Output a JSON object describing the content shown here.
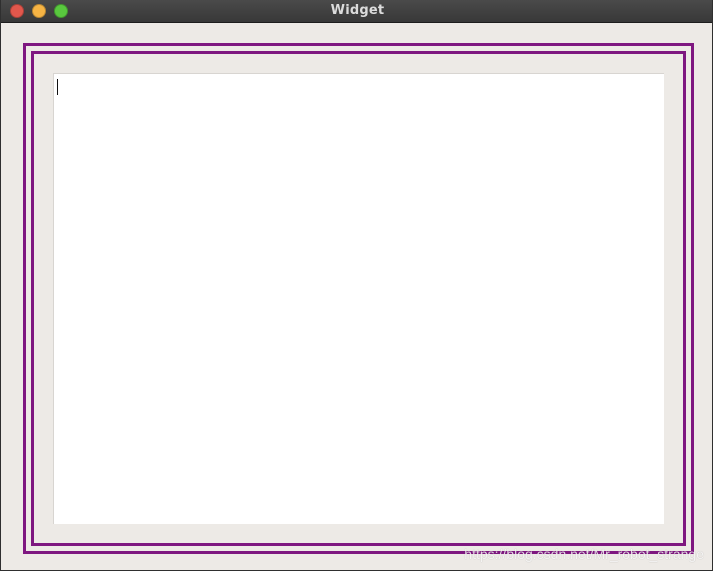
{
  "window": {
    "title": "Widget",
    "controls": {
      "close_color": "#e2574c",
      "minimize_color": "#f6b444",
      "maximize_color": "#59c83e"
    }
  },
  "content": {
    "frame_color": "#7e1780",
    "text_value": "",
    "watermark": "https://blog.csdn.net/Mr_robot_strange"
  }
}
